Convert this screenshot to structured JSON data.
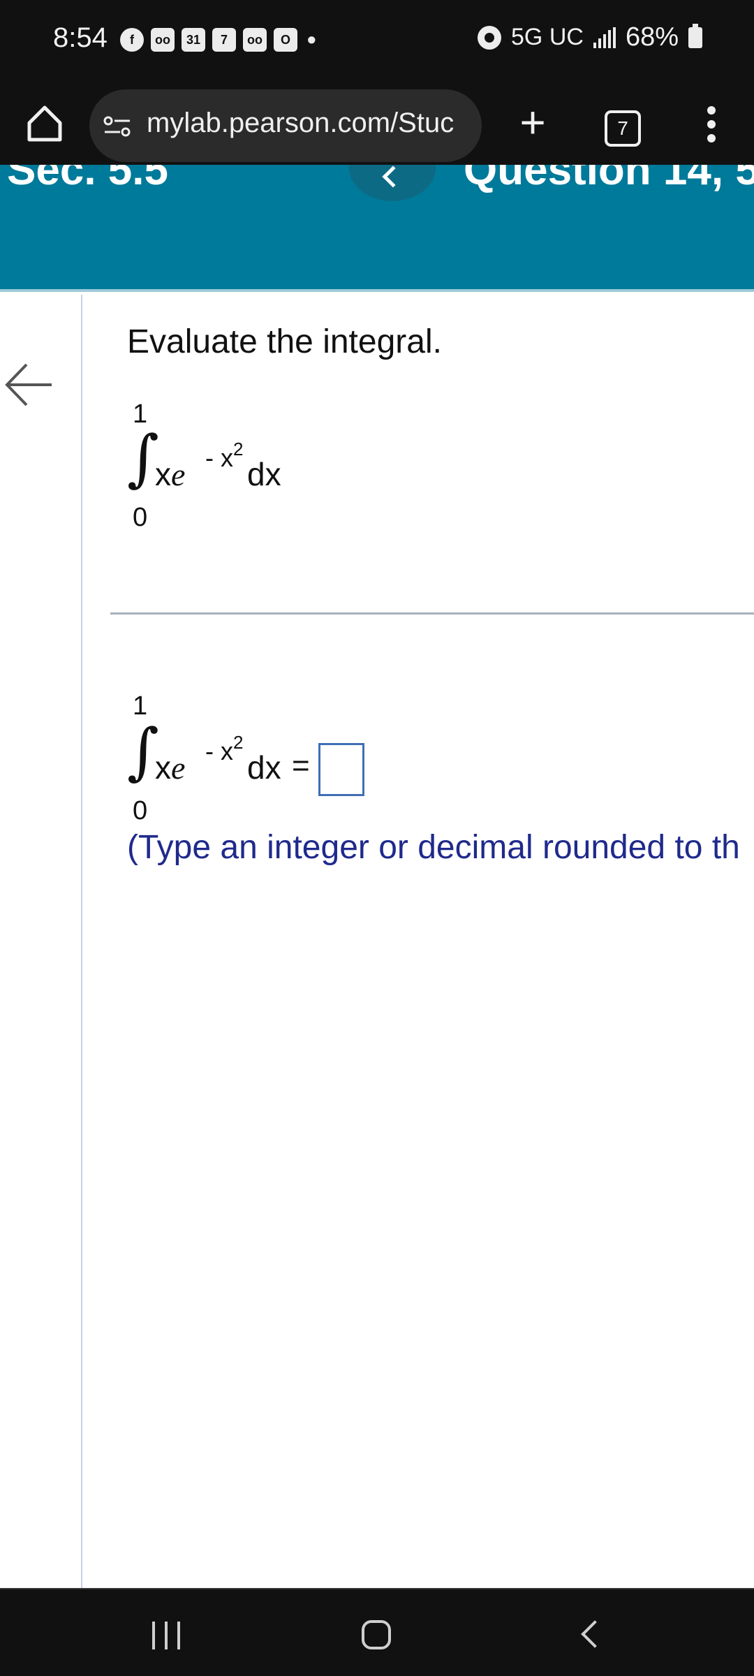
{
  "status_bar": {
    "time": "8:54",
    "notification_icons": [
      "facebook-icon",
      "voicemail-icon",
      "calendar-icon",
      "calendar-icon",
      "voicemail-icon",
      "outlook-icon"
    ],
    "calendar_1": "31",
    "calendar_2": "7",
    "dot": "•",
    "network": "5G UC",
    "battery": "68%"
  },
  "browser": {
    "url": "mylab.pearson.com/Stuc",
    "new_tab": "+",
    "tab_count": "7"
  },
  "header": {
    "section": "Sec. 5.5",
    "question": "Question 14, 5."
  },
  "problem": {
    "prompt": "Evaluate the integral.",
    "integral": {
      "upper_limit": "1",
      "lower_limit": "0",
      "integrand": "x",
      "base": "e",
      "exponent": "- x",
      "exponent_power": "2",
      "differential": "dx"
    },
    "answer": {
      "upper_limit": "1",
      "lower_limit": "0",
      "integrand": "x",
      "base": "e",
      "exponent": "- x",
      "exponent_power": "2",
      "differential": "dx",
      "equals": "=",
      "value": ""
    },
    "hint": "(Type an integer or decimal rounded to th"
  },
  "colors": {
    "header_bg": "#007a9a",
    "hint_text": "#1f2a8c",
    "answer_border": "#3f6fb5"
  }
}
